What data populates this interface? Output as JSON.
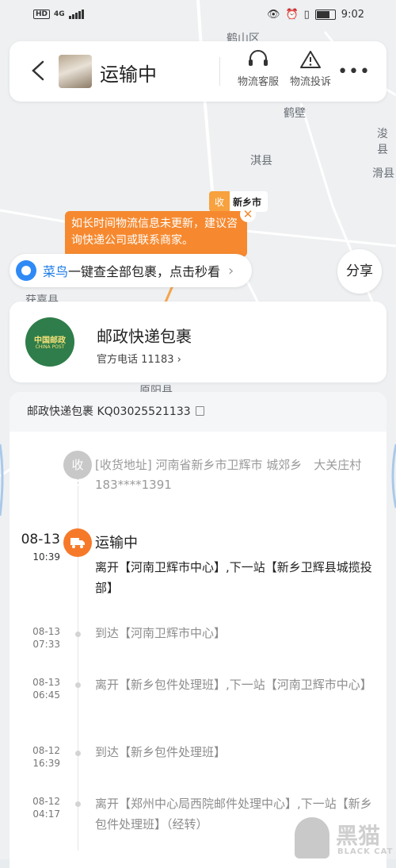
{
  "status_bar": {
    "network": "4G",
    "hd": "HD",
    "time": "9:02"
  },
  "map": {
    "labels": [
      "鹤山区",
      "鹤壁",
      "浚县",
      "淇县",
      "滑县",
      "获嘉县",
      "原阳县"
    ],
    "collect_badge": "收",
    "city_chip": "新乡市",
    "tip": "如长时间物流信息未更新，建议咨询快递公司或联系商家。",
    "tip_close": "✕"
  },
  "header": {
    "title": "运输中",
    "service_label": "物流客服",
    "complaint_label": "物流投诉",
    "more_label": "•••"
  },
  "cainiao": {
    "brand": "菜鸟",
    "text": "一键查全部包裹，点击秒看",
    "chevron": "›"
  },
  "share_label": "分享",
  "carrier": {
    "logo_cn": "中国邮政",
    "logo_en": "CHINA POST",
    "name": "邮政快递包裹",
    "phone": "官方电话 11183 ›"
  },
  "tracking": {
    "header": "邮政快递包裹 KQ03025521133",
    "receiver_badge": "收",
    "receiver_address": "[收货地址] 河南省新乡市卫辉市 城郊乡　大关庄村 183****1391",
    "current": {
      "date": "08-13",
      "time": "10:39",
      "status": "运输中",
      "desc": "离开【河南卫辉市中心】,下一站【新乡卫辉县城揽投部】"
    },
    "events": [
      {
        "date": "08-13",
        "time": "07:33",
        "text": "到达【河南卫辉市中心】"
      },
      {
        "date": "08-13",
        "time": "06:45",
        "text": "离开【新乡包件处理班】,下一站【河南卫辉市中心】"
      },
      {
        "date": "08-12",
        "time": "16:39",
        "text": "到达【新乡包件处理班】"
      },
      {
        "date": "08-12",
        "time": "04:17",
        "text": "离开【郑州中心局西院邮件处理中心】,下一站【新乡包件处理班】（经转）"
      }
    ]
  },
  "watermark": {
    "text": "黑猫",
    "sub": "BLACK CAT"
  },
  "colors": {
    "accent": "#f6792a",
    "tip": "#f6892f",
    "cainiao": "#1c7ce6",
    "post_green": "#2f7d4a"
  }
}
